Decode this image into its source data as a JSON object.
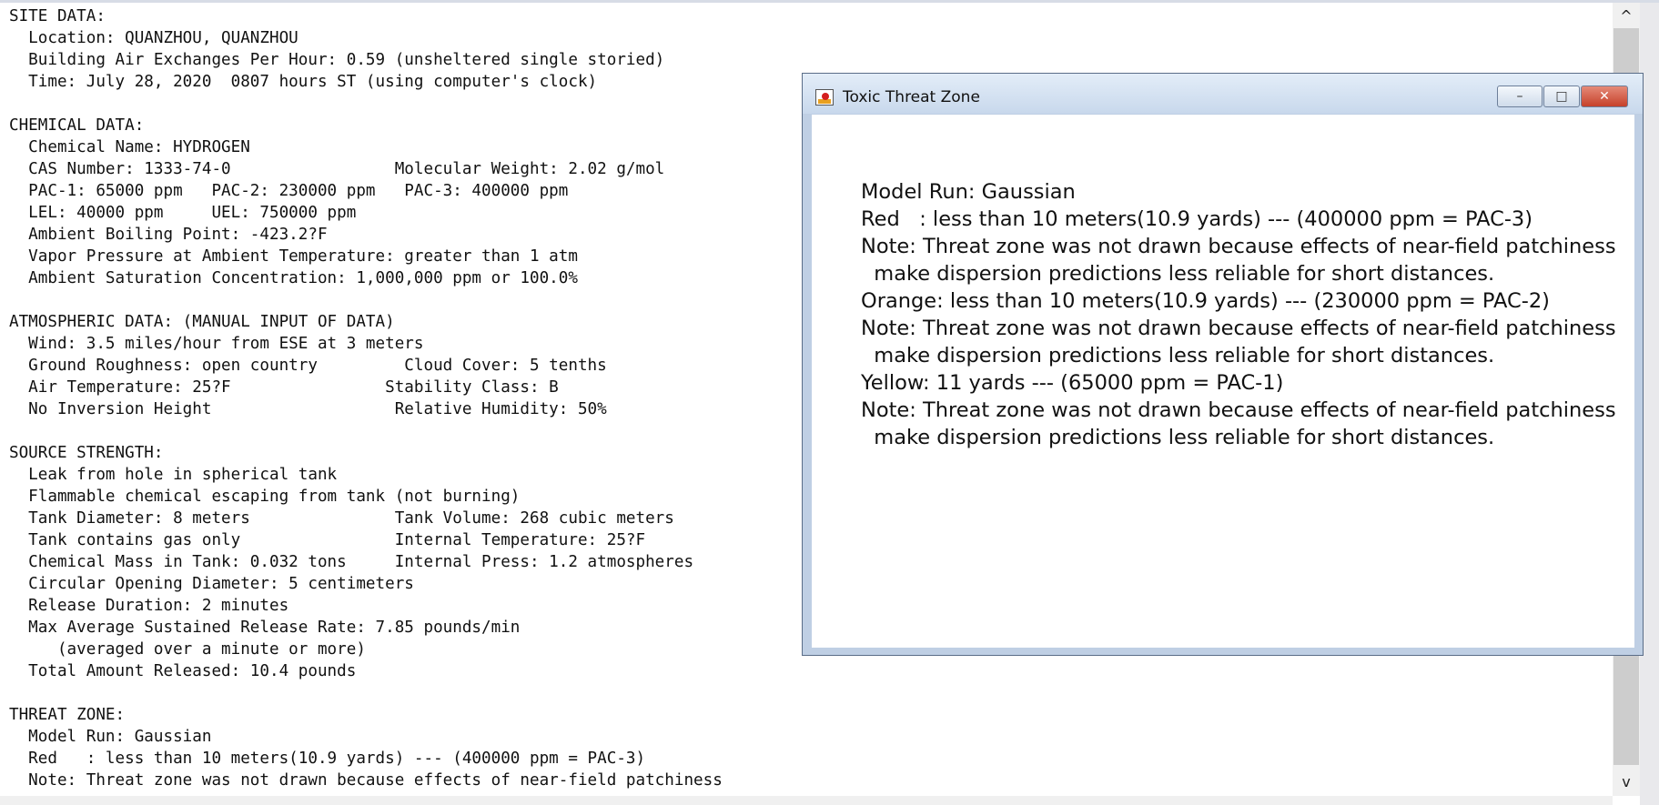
{
  "report": {
    "lines": [
      "SITE DATA:",
      "  Location: QUANZHOU, QUANZHOU",
      "  Building Air Exchanges Per Hour: 0.59 (unsheltered single storied)",
      "  Time: July 28, 2020  0807 hours ST (using computer's clock)",
      "",
      "CHEMICAL DATA:",
      "  Chemical Name: HYDROGEN",
      "  CAS Number: 1333-74-0                 Molecular Weight: 2.02 g/mol",
      "  PAC-1: 65000 ppm   PAC-2: 230000 ppm   PAC-3: 400000 ppm",
      "  LEL: 40000 ppm     UEL: 750000 ppm",
      "  Ambient Boiling Point: -423.2?F",
      "  Vapor Pressure at Ambient Temperature: greater than 1 atm",
      "  Ambient Saturation Concentration: 1,000,000 ppm or 100.0%",
      "",
      "ATMOSPHERIC DATA: (MANUAL INPUT OF DATA)",
      "  Wind: 3.5 miles/hour from ESE at 3 meters",
      "  Ground Roughness: open country         Cloud Cover: 5 tenths",
      "  Air Temperature: 25?F                Stability Class: B",
      "  No Inversion Height                   Relative Humidity: 50%",
      "",
      "SOURCE STRENGTH:",
      "  Leak from hole in spherical tank",
      "  Flammable chemical escaping from tank (not burning)",
      "  Tank Diameter: 8 meters               Tank Volume: 268 cubic meters",
      "  Tank contains gas only                Internal Temperature: 25?F",
      "  Chemical Mass in Tank: 0.032 tons     Internal Press: 1.2 atmospheres",
      "  Circular Opening Diameter: 5 centimeters",
      "  Release Duration: 2 minutes",
      "  Max Average Sustained Release Rate: 7.85 pounds/min",
      "     (averaged over a minute or more)",
      "  Total Amount Released: 10.4 pounds",
      "",
      "THREAT ZONE:",
      "  Model Run: Gaussian",
      "  Red   : less than 10 meters(10.9 yards) --- (400000 ppm = PAC-3)",
      "  Note: Threat zone was not drawn because effects of near-field patchiness"
    ]
  },
  "scrollbar": {
    "up_icon": "chevron-up-icon",
    "down_icon": "chevron-down-icon",
    "up_glyph": "^",
    "down_glyph": "v"
  },
  "window": {
    "title": "Toxic Threat Zone",
    "icon": "threat-zone-app-icon",
    "controls": {
      "minimize": "minimize-icon",
      "maximize": "maximize-icon",
      "close": "close-icon"
    },
    "lines": [
      "Model Run: Gaussian",
      "Red   : less than 10 meters(10.9 yards) --- (400000 ppm = PAC-3)",
      "Note: Threat zone was not drawn because effects of near-field patchiness",
      "  make dispersion predictions less reliable for short distances.",
      "Orange: less than 10 meters(10.9 yards) --- (230000 ppm = PAC-2)",
      "Note: Threat zone was not drawn because effects of near-field patchiness",
      "  make dispersion predictions less reliable for short distances.",
      "Yellow: 11 yards --- (65000 ppm = PAC-1)",
      "Note: Threat zone was not drawn because effects of near-field patchiness",
      "  make dispersion predictions less reliable for short distances."
    ]
  },
  "colors": {
    "window_frame": "#bfcfe4",
    "close_button": "#c6412a"
  }
}
